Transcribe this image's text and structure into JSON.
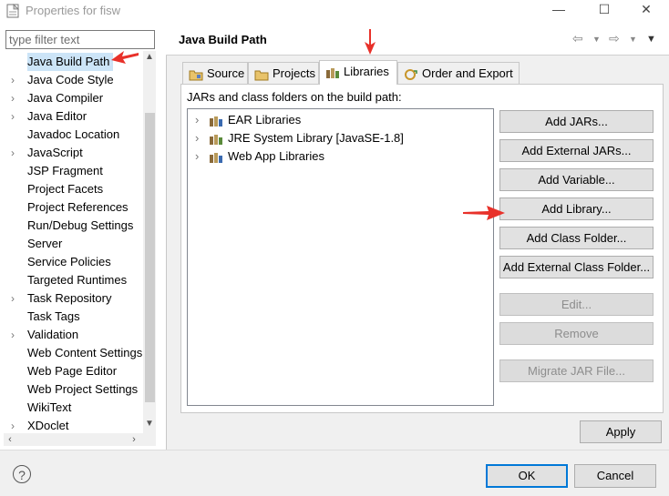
{
  "window": {
    "title": "Properties for fisw",
    "minimize": "—",
    "maximize": "☐",
    "close": "✕"
  },
  "filter": {
    "placeholder": "type filter text"
  },
  "nav": {
    "items": [
      {
        "label": "Java Build Path",
        "chevron": "",
        "selected": true
      },
      {
        "label": "Java Code Style",
        "chevron": "›"
      },
      {
        "label": "Java Compiler",
        "chevron": "›"
      },
      {
        "label": "Java Editor",
        "chevron": "›"
      },
      {
        "label": "Javadoc Location",
        "chevron": ""
      },
      {
        "label": "JavaScript",
        "chevron": "›"
      },
      {
        "label": "JSP Fragment",
        "chevron": ""
      },
      {
        "label": "Project Facets",
        "chevron": ""
      },
      {
        "label": "Project References",
        "chevron": ""
      },
      {
        "label": "Run/Debug Settings",
        "chevron": ""
      },
      {
        "label": "Server",
        "chevron": ""
      },
      {
        "label": "Service Policies",
        "chevron": ""
      },
      {
        "label": "Targeted Runtimes",
        "chevron": ""
      },
      {
        "label": "Task Repository",
        "chevron": "›"
      },
      {
        "label": "Task Tags",
        "chevron": ""
      },
      {
        "label": "Validation",
        "chevron": "›"
      },
      {
        "label": "Web Content Settings",
        "chevron": ""
      },
      {
        "label": "Web Page Editor",
        "chevron": ""
      },
      {
        "label": "Web Project Settings",
        "chevron": ""
      },
      {
        "label": "WikiText",
        "chevron": ""
      },
      {
        "label": "XDoclet",
        "chevron": "›"
      }
    ]
  },
  "page": {
    "title": "Java Build Path",
    "tabs": [
      {
        "label": "Source",
        "icon": "source-folder-icon"
      },
      {
        "label": "Projects",
        "icon": "projects-folder-icon"
      },
      {
        "label": "Libraries",
        "icon": "libraries-icon",
        "active": true
      },
      {
        "label": "Order and Export",
        "icon": "order-export-icon"
      }
    ],
    "section_label": "JARs and class folders on the build path:",
    "libraries": [
      {
        "label": "EAR Libraries"
      },
      {
        "label": "JRE System Library [JavaSE-1.8]"
      },
      {
        "label": "Web App Libraries"
      }
    ],
    "buttons": {
      "add_jars": "Add JARs...",
      "add_external_jars": "Add External JARs...",
      "add_variable": "Add Variable...",
      "add_library": "Add Library...",
      "add_class_folder": "Add Class Folder...",
      "add_external_class_folder": "Add External Class Folder...",
      "edit": "Edit...",
      "remove": "Remove",
      "migrate_jar": "Migrate JAR File..."
    },
    "apply": "Apply"
  },
  "footer": {
    "help": "?",
    "ok": "OK",
    "cancel": "Cancel"
  },
  "colors": {
    "annotation_red": "#e8312a",
    "selection": "#cce4f7",
    "default_button_border": "#0078d7"
  }
}
